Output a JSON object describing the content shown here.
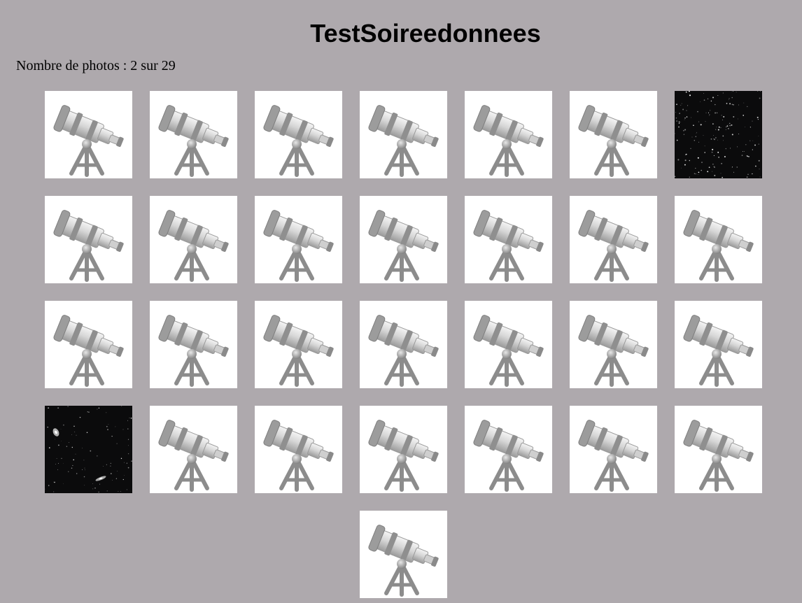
{
  "page": {
    "title": "TestSoireedonnees",
    "photo_count_text": "Nombre de photos : 2 sur 29"
  },
  "gallery": {
    "thumbnails": [
      {
        "kind": "placeholder",
        "icon": "telescope-icon"
      },
      {
        "kind": "placeholder",
        "icon": "telescope-icon"
      },
      {
        "kind": "placeholder",
        "icon": "telescope-icon"
      },
      {
        "kind": "placeholder",
        "icon": "telescope-icon"
      },
      {
        "kind": "placeholder",
        "icon": "telescope-icon"
      },
      {
        "kind": "placeholder",
        "icon": "telescope-icon"
      },
      {
        "kind": "photo",
        "subject": "star-field"
      },
      {
        "kind": "placeholder",
        "icon": "telescope-icon"
      },
      {
        "kind": "placeholder",
        "icon": "telescope-icon"
      },
      {
        "kind": "placeholder",
        "icon": "telescope-icon"
      },
      {
        "kind": "placeholder",
        "icon": "telescope-icon"
      },
      {
        "kind": "placeholder",
        "icon": "telescope-icon"
      },
      {
        "kind": "placeholder",
        "icon": "telescope-icon"
      },
      {
        "kind": "placeholder",
        "icon": "telescope-icon"
      },
      {
        "kind": "placeholder",
        "icon": "telescope-icon"
      },
      {
        "kind": "placeholder",
        "icon": "telescope-icon"
      },
      {
        "kind": "placeholder",
        "icon": "telescope-icon"
      },
      {
        "kind": "placeholder",
        "icon": "telescope-icon"
      },
      {
        "kind": "placeholder",
        "icon": "telescope-icon"
      },
      {
        "kind": "placeholder",
        "icon": "telescope-icon"
      },
      {
        "kind": "placeholder",
        "icon": "telescope-icon"
      },
      {
        "kind": "photo",
        "subject": "galaxies"
      },
      {
        "kind": "placeholder",
        "icon": "telescope-icon"
      },
      {
        "kind": "placeholder",
        "icon": "telescope-icon"
      },
      {
        "kind": "placeholder",
        "icon": "telescope-icon"
      },
      {
        "kind": "placeholder",
        "icon": "telescope-icon"
      },
      {
        "kind": "placeholder",
        "icon": "telescope-icon"
      },
      {
        "kind": "placeholder",
        "icon": "telescope-icon"
      },
      {
        "kind": "placeholder",
        "icon": "telescope-icon"
      }
    ]
  },
  "colors": {
    "background": "#aea9ad",
    "tile_background": "#ffffff",
    "photo_background": "#0b0b0c",
    "telescope_gray": "#8c8c8c"
  }
}
